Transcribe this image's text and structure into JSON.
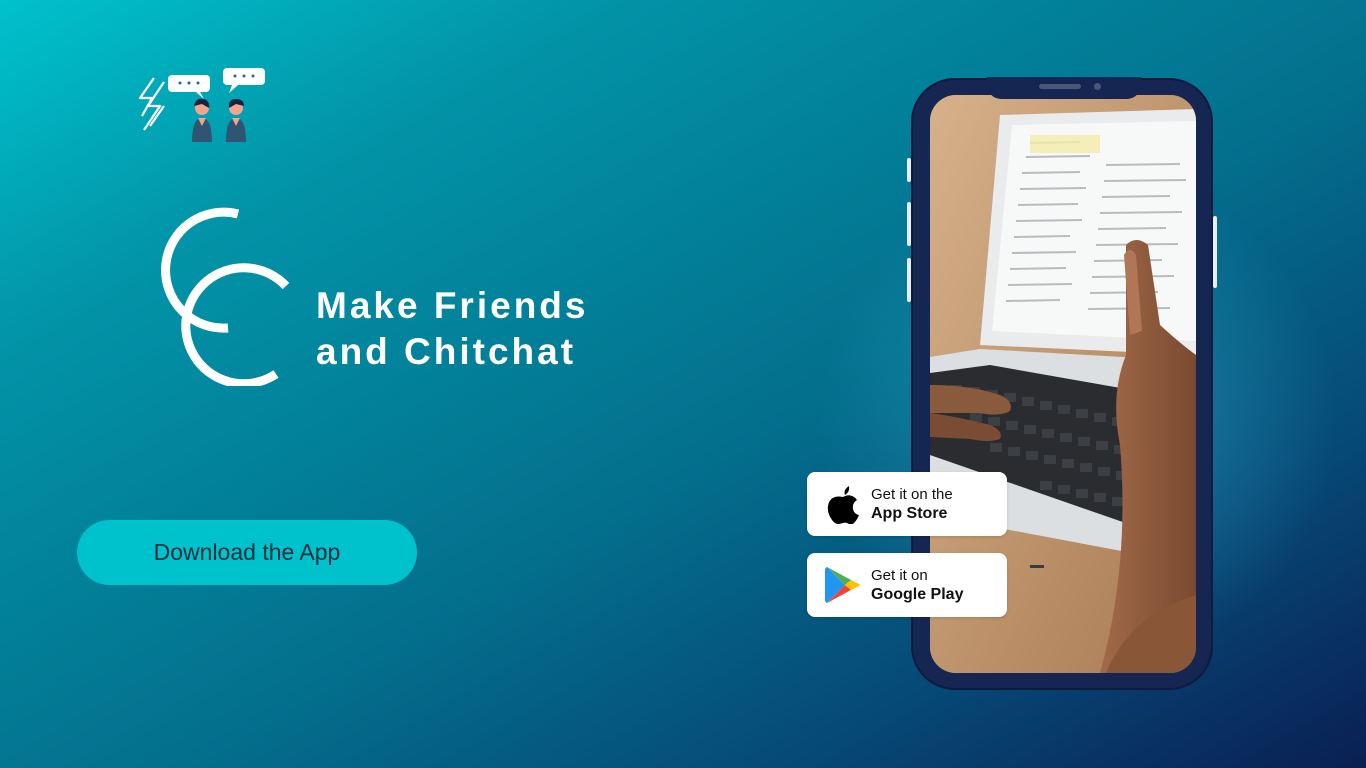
{
  "brand": {
    "tagline_line1": "Make Friends",
    "tagline_line2": "and Chitchat",
    "logo_icon": "people-chatting-icon",
    "monogram": "CC"
  },
  "cta": {
    "download_label": "Download the App"
  },
  "badges": {
    "app_store": {
      "line1": "Get it on the",
      "line2": "App Store",
      "icon": "apple-icon"
    },
    "google_play": {
      "line1": "Get it on",
      "line2": "Google Play",
      "icon": "google-play-icon"
    }
  },
  "phone": {
    "screen_image": "hands-typing-on-laptop-photo"
  },
  "colors": {
    "bg_start": "#00c2cc",
    "bg_end": "#0a1f52",
    "button": "#00c2cc",
    "phone_frame": "#152652",
    "text": "#ffffff"
  }
}
